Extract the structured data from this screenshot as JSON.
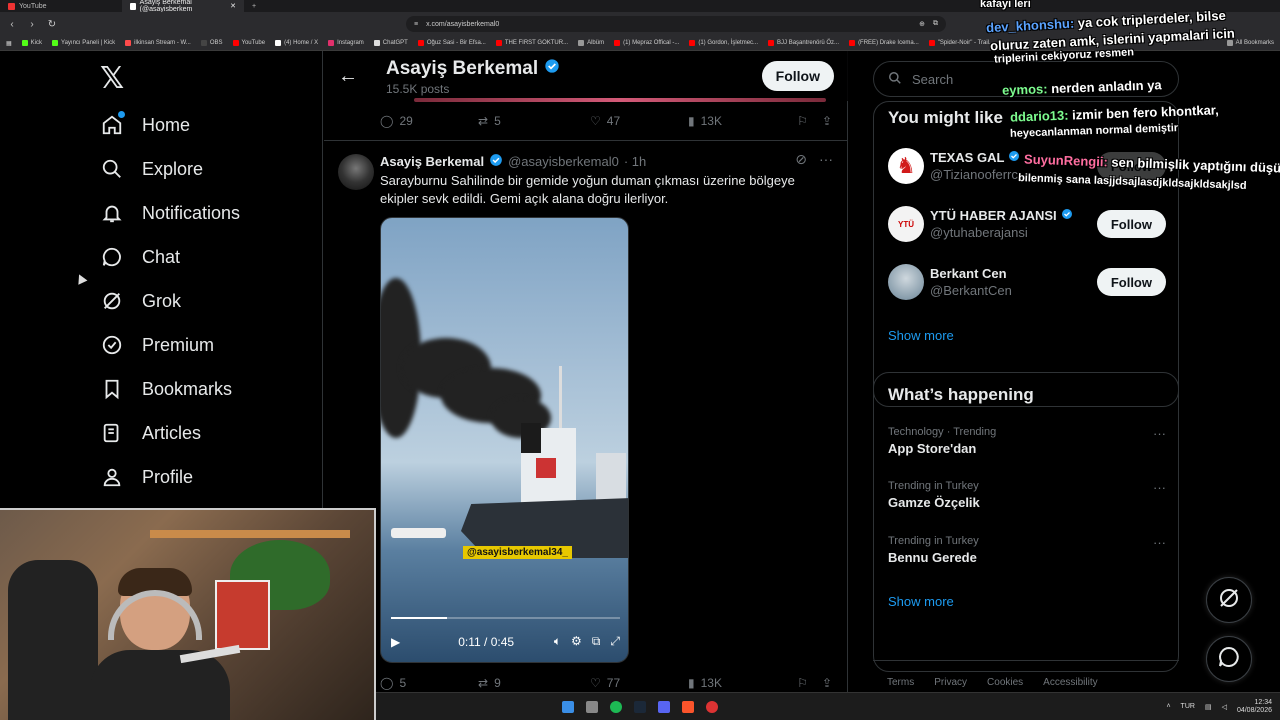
{
  "browser": {
    "tabs": [
      {
        "title": "YouTube",
        "active": false
      },
      {
        "title": "Asayiş Berkemal (@asayisberkem",
        "active": true
      }
    ],
    "url": "x.com/asayisberkemal0",
    "bookmarks": [
      "Kick",
      "Yayıncı Paneli | Kick",
      "ilkinsan Stream - W...",
      "OBS",
      "YouTube",
      "(4) Home / X",
      "Instagram",
      "ChatGPT",
      "Oğuz Sasi - Bir Efsa...",
      "THE FIRST GOKTUR...",
      "Albüm",
      "(1) Mepraz Offical -...",
      "(1) Gordon, İşletmec...",
      "BJJ Başantrenörü Öz...",
      "(FREE) Drake Icema...",
      "\"Spider-Noir\" - Trail..."
    ],
    "all_bookmarks": "All Bookmarks"
  },
  "nav": {
    "items": [
      {
        "label": "Home",
        "icon": "home-icon"
      },
      {
        "label": "Explore",
        "icon": "search-icon"
      },
      {
        "label": "Notifications",
        "icon": "bell-icon"
      },
      {
        "label": "Chat",
        "icon": "chat-icon"
      },
      {
        "label": "Grok",
        "icon": "grok-icon"
      },
      {
        "label": "Premium",
        "icon": "verified-icon"
      },
      {
        "label": "Bookmarks",
        "icon": "bookmark-icon"
      },
      {
        "label": "Articles",
        "icon": "articles-icon"
      },
      {
        "label": "Profile",
        "icon": "profile-icon"
      }
    ]
  },
  "profile_header": {
    "name": "Asayiş Berkemal",
    "posts": "15.5K posts",
    "follow_label": "Follow"
  },
  "prev_tweet_stats": {
    "replies": "29",
    "reposts": "5",
    "likes": "47",
    "views": "13K"
  },
  "tweet": {
    "name": "Asayiş Berkemal",
    "handle": "@asayisberkemal0",
    "time": "· 1h",
    "text": "Sarayburnu Sahilinde bir gemide yoğun duman çıkması üzerine bölgeye ekipler sevk edildi. Gemi açık alana doğru ilerliyor.",
    "video": {
      "watermark": "@asayisberkemal34_",
      "time": "0:11 / 0:45",
      "progress": 0.244
    },
    "stats": {
      "replies": "5",
      "reposts": "9",
      "likes": "77",
      "views": "13K"
    }
  },
  "sidebar": {
    "search_placeholder": "Search",
    "wtf_title": "You might like",
    "wtf": [
      {
        "name": "TEXAS GAL",
        "handle": "@Tizianooferrc",
        "follow": "Follow",
        "color": "#d11a1a"
      },
      {
        "name": "YTÜ HABER AJANSI",
        "handle": "@ytuhaberajansi",
        "follow": "Follow",
        "color": "#f3f3f3"
      },
      {
        "name": "Berkant Cen",
        "handle": "@BerkantCen",
        "follow": "Follow",
        "color": "#8aa4b8"
      }
    ],
    "show_more": "Show more",
    "happening_title": "What’s happening",
    "trends": [
      {
        "meta": "Technology · Trending",
        "title": "App Store'dan"
      },
      {
        "meta": "Trending in Turkey",
        "title": "Gamze Özçelik"
      },
      {
        "meta": "Trending in Turkey",
        "title": "Bennu Gerede"
      }
    ],
    "show_more_2": "Show more",
    "footer": [
      "Terms",
      "Privacy",
      "Cookies",
      "Accessibility"
    ]
  },
  "chat_overlay": [
    {
      "user": "",
      "text": "kafayi leri"
    },
    {
      "user": "dev_khonshu:",
      "text": " ya cok triplerdeler, bilse"
    },
    {
      "user": "",
      "text": "oluruz zaten amk, islerini yapmalari icin"
    },
    {
      "user": "",
      "text": "triplerini cekiyoruz resmen"
    },
    {
      "user": "eymos:",
      "text": " nerden anladın ya"
    },
    {
      "user": "ddario13:",
      "text": " izmir ben fero khontkar,"
    },
    {
      "user": "",
      "text": "heyecanlanman normal demiştir"
    },
    {
      "user": "SuyunRengii:",
      "text": " sen bilmişlik yaptığını düşü"
    },
    {
      "user": "",
      "text": "bilenmiş sana lasjjdsajlasdjkldsajkldsakjlsd"
    }
  ],
  "taskbar": {
    "lang": "TUR",
    "time": "12:34",
    "date": "04/08/2026"
  },
  "colors": {
    "accent": "#1d9bf0",
    "bg": "#000000",
    "border": "#2f3336"
  }
}
